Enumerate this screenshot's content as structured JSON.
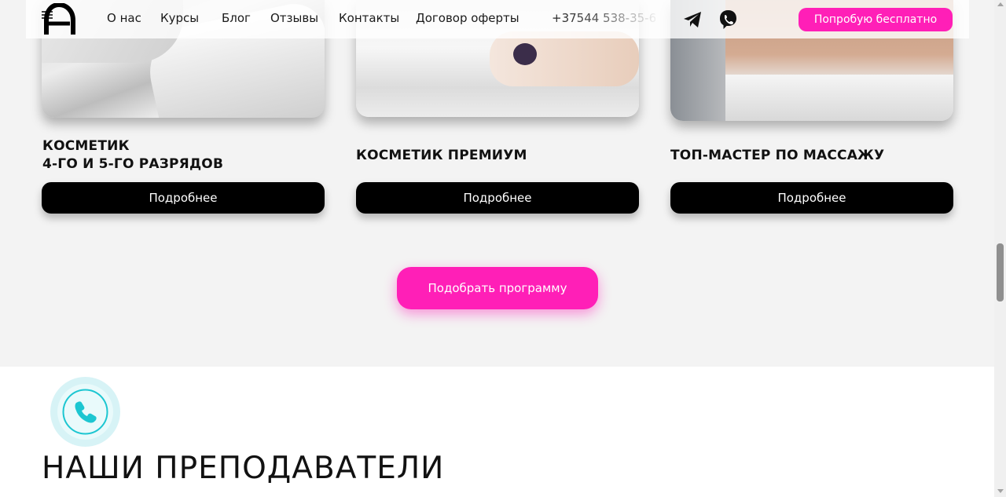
{
  "header": {
    "nav": [
      "О нас",
      "Курсы",
      "Блог",
      "Отзывы",
      "Контакты",
      "Договор оферты"
    ],
    "phone": "+37544 538-35-6",
    "cta_label": "Попробую бесплатно"
  },
  "courses": [
    {
      "title_line1": "Косметик",
      "title_line2": "4-го и 5-го разрядов",
      "button_label": "Подробнее"
    },
    {
      "title_line1": "Косметик премиум",
      "button_label": "Подробнее"
    },
    {
      "title_line1": "Топ-мастер по массажу",
      "button_label": "Подробнее"
    }
  ],
  "pick_program_label": "Подобрать программу",
  "teachers": {
    "title": "НАШИ ПРЕПОДАВАТЕЛИ"
  },
  "icons": {
    "logo": "logo-icon",
    "telegram": "telegram-icon",
    "viber": "viber-icon",
    "call": "phone-icon"
  },
  "colors": {
    "accent": "#ff1fb7",
    "call_widget": "#1cc6d1",
    "button_dark": "#000000"
  }
}
